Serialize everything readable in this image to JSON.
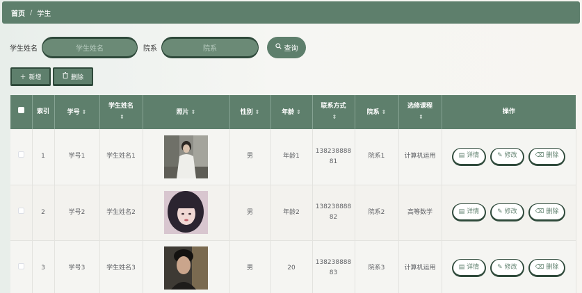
{
  "breadcrumb": {
    "home": "首页",
    "separator": "/",
    "current": "学生"
  },
  "search": {
    "name_label": "学生姓名",
    "name_placeholder": "学生姓名",
    "dept_label": "院系",
    "dept_placeholder": "院系",
    "query_label": "查询"
  },
  "actions": {
    "add_label": "新增",
    "delete_label": "删除"
  },
  "table": {
    "headers": {
      "index": "索引",
      "student_no": "学号",
      "student_name": "学生姓名",
      "photo": "照片",
      "gender": "性别",
      "age": "年龄",
      "contact": "联系方式",
      "dept": "院系",
      "course": "选修课程",
      "ops": "操作"
    },
    "op_labels": {
      "detail": "详情",
      "edit": "修改",
      "delete": "删除"
    },
    "rows": [
      {
        "index": "1",
        "student_no": "学号1",
        "student_name": "学生姓名1",
        "gender": "男",
        "age": "年龄1",
        "contact": "13823888881",
        "dept": "院系1",
        "course": "计算机运用",
        "photo_icon": "student-photo-1"
      },
      {
        "index": "2",
        "student_no": "学号2",
        "student_name": "学生姓名2",
        "gender": "男",
        "age": "年龄2",
        "contact": "13823888882",
        "dept": "院系2",
        "course": "高等数学",
        "photo_icon": "student-photo-2"
      },
      {
        "index": "3",
        "student_no": "学号3",
        "student_name": "学生姓名3",
        "gender": "男",
        "age": "20",
        "contact": "13823888883",
        "dept": "院系3",
        "course": "计算机运用",
        "photo_icon": "student-photo-3"
      }
    ]
  },
  "colors": {
    "primary": "#5e7f6c",
    "dark": "#2f4a3b"
  }
}
